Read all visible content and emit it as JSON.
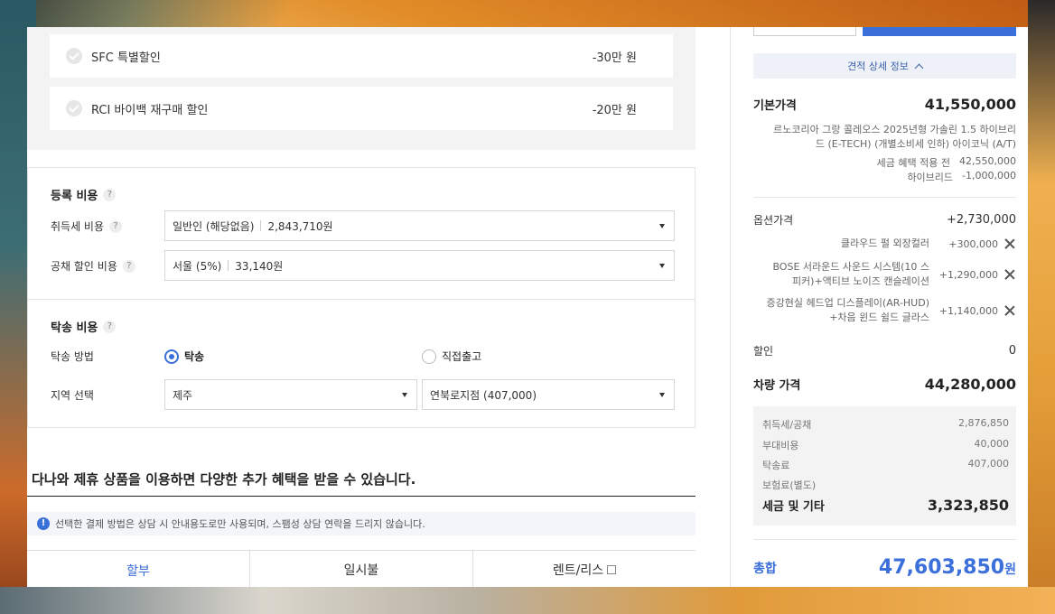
{
  "discounts": [
    {
      "label": "SFC 특별할인",
      "amount": "-30만 원"
    },
    {
      "label": "RCI 바이백 재구매 할인",
      "amount": "-20만 원"
    }
  ],
  "registration": {
    "title": "등록 비용",
    "help": "?",
    "acq_tax_label": "취득세 비용",
    "acq_tax_value": "일반인 (해당없음)",
    "acq_tax_amount": "2,843,710원",
    "bond_label": "공채 할인 비용",
    "bond_value": "서울 (5%)",
    "bond_amount": "33,140원"
  },
  "delivery": {
    "title": "탁송 비용",
    "help": "?",
    "method_label": "탁송 방법",
    "opt_delivery": "탁송",
    "opt_pickup": "직접출고",
    "region_label": "지역 선택",
    "region_value": "제주",
    "branch_value": "연북로지점 (407,000)"
  },
  "partner": {
    "title": "다나와 제휴 상품을 이용하면 다양한 추가 혜택을 받을 수 있습니다.",
    "notice_icon": "!",
    "notice": "선택한 결제 방법은 상담 시 안내용도로만 사용되며, 스팸성 상담 연락을 드리지 않습니다."
  },
  "tabs": [
    "할부",
    "일시불",
    "렌트/리스"
  ],
  "summary": {
    "detail_toggle": "견적 상세 정보",
    "base_label": "기본가격",
    "base_value": "41,550,000",
    "model_desc_1": "르노코리아 그랑 콜레오스 2025년형 가솔린 1.5 하이브리",
    "model_desc_2": "드 (E-TECH) (개별소비세 인하) 아이코닉 (A/T)",
    "pre_tax_label": "세금 혜택 적용 전",
    "pre_tax_value": "42,550,000",
    "hybrid_label": "하이브리드",
    "hybrid_value": "-1,000,000",
    "option_label": "옵션가격",
    "option_value": "+2,730,000",
    "options": [
      {
        "name1": "클라우드 펄 외장컬러",
        "name2": "",
        "price": "+300,000"
      },
      {
        "name1": "BOSE 서라운드 사운드 시스템(10 스",
        "name2": "피커)+액티브 노이즈 캔슬레이션",
        "price": "+1,290,000"
      },
      {
        "name1": "증강현실 헤드업 디스플레이(AR-HUD)",
        "name2": "+차음 윈드 쉴드 글라스",
        "price": "+1,140,000"
      }
    ],
    "discount_label": "할인",
    "discount_value": "0",
    "car_price_label": "차량 가격",
    "car_price_value": "44,280,000",
    "taxes": [
      {
        "label": "취득세/공채",
        "value": "2,876,850"
      },
      {
        "label": "부대비용",
        "value": "40,000"
      },
      {
        "label": "탁송료",
        "value": "407,000"
      },
      {
        "label": "보험료(별도)",
        "value": ""
      }
    ],
    "tax_total_label": "세금 및 기타",
    "tax_total_value": "3,323,850",
    "grand_label": "총합",
    "grand_value": "47,603,850",
    "grand_unit": "원"
  },
  "colors": {
    "accent": "#3b6fd9"
  }
}
